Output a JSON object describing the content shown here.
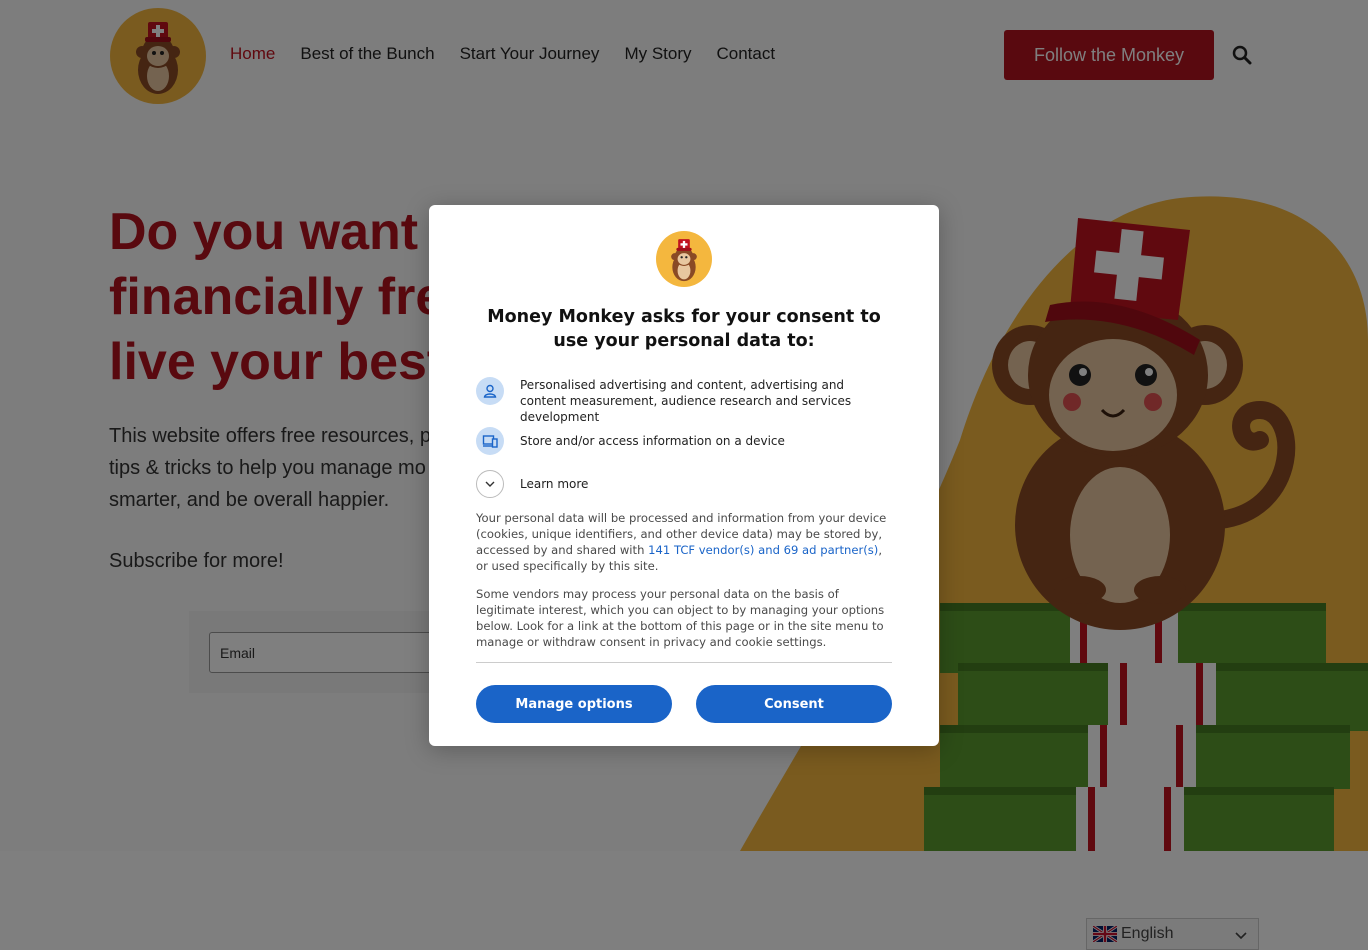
{
  "colors": {
    "brand_red": "#b3121f",
    "nav_active": "#c1121f",
    "consent_blue": "#1a64c8",
    "logo_orange": "#f4b73e",
    "overlay": "rgba(0,0,0,0.5)"
  },
  "header": {
    "logo_icon": "monkey-with-swiss-hat-logo",
    "nav": [
      {
        "label": "Home",
        "active": true
      },
      {
        "label": "Best of the Bunch",
        "active": false
      },
      {
        "label": "Start Your Journey",
        "active": false
      },
      {
        "label": "My Story",
        "active": false
      },
      {
        "label": "Contact",
        "active": false
      }
    ],
    "cta_label": "Follow the Monkey",
    "search_icon": "search-icon"
  },
  "hero": {
    "title_lines": [
      "Do you want t",
      "financially fre",
      "live your best"
    ],
    "text_lines": [
      "This website offers free resources, p",
      "tips & tricks to help you manage mo",
      "smarter, and be overall happier."
    ],
    "subscribe": "Subscribe for more!",
    "email_placeholder": "Email"
  },
  "language": {
    "label": "English",
    "flag": "uk-flag-icon"
  },
  "consent": {
    "title": "Money Monkey asks for your consent to use your personal data to:",
    "purposes": [
      {
        "icon": "person-icon",
        "text": "Personalised advertising and content, advertising and content measurement, audience research and services development"
      },
      {
        "icon": "devices-icon",
        "text": "Store and/or access information on a device"
      }
    ],
    "learn_more": "Learn more",
    "para1_before": "Your personal data will be processed and information from your device (cookies, unique identifiers, and other device data) may be stored by, accessed by and shared with ",
    "para1_link": "141 TCF vendor(s) and 69 ad partner(s)",
    "para1_after": ", or used specifically by this site.",
    "para2": "Some vendors may process your personal data on the basis of legitimate interest, which you can object to by managing your options below. Look for a link at the bottom of this page or in the site menu to manage or withdraw consent in privacy and cookie settings.",
    "manage_label": "Manage options",
    "consent_label": "Consent"
  }
}
